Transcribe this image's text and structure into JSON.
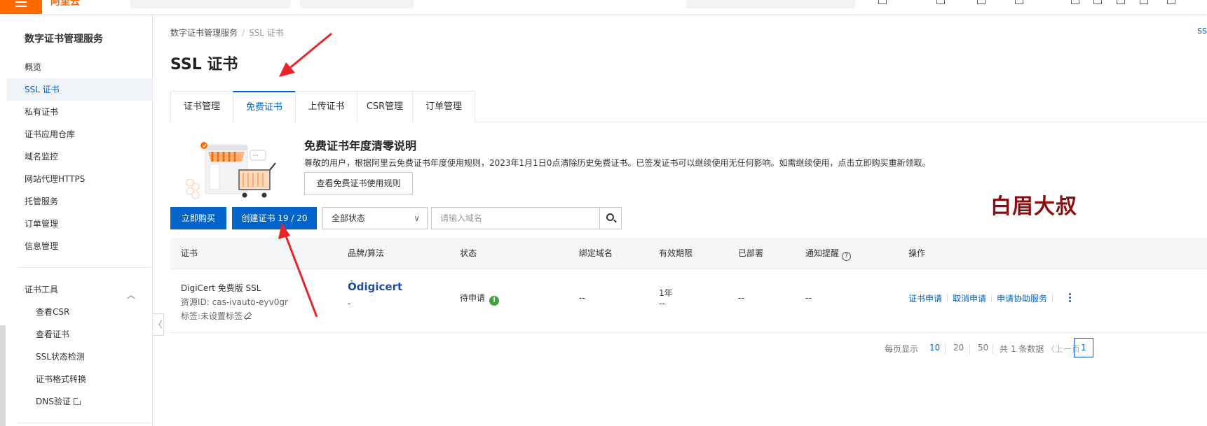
{
  "sidebar": {
    "title": "数字证书管理服务",
    "items": [
      {
        "label": "概览"
      },
      {
        "label": "SSL 证书",
        "active": true
      },
      {
        "label": "私有证书"
      },
      {
        "label": "证书应用仓库"
      },
      {
        "label": "域名监控"
      },
      {
        "label": "网站代理HTTPS"
      },
      {
        "label": "托管服务"
      },
      {
        "label": "订单管理"
      },
      {
        "label": "信息管理"
      }
    ],
    "tools_title": "证书工具",
    "tools": [
      {
        "label": "查看CSR"
      },
      {
        "label": "查看证书"
      },
      {
        "label": "SSL状态检测"
      },
      {
        "label": "证书格式转换"
      },
      {
        "label": "DNS验证"
      }
    ]
  },
  "breadcrumb": {
    "parent": "数字证书管理服务",
    "sep": "/",
    "current": "SSL 证书"
  },
  "top_right_link": "SS",
  "page_title": "SSL 证书",
  "tabs": [
    {
      "label": "证书管理"
    },
    {
      "label": "免费证书",
      "active": true
    },
    {
      "label": "上传证书"
    },
    {
      "label": "CSR管理"
    },
    {
      "label": "订单管理"
    }
  ],
  "banner": {
    "title": "免费证书年度清零说明",
    "text": "尊敬的用户，根据阿里云免费证书年度使用规则，2023年1月1日0点清除历史免费证书。已签发证书可以继续使用无任何影响。如需继续使用，点击立即购买重新领取。",
    "rules_button": "查看免费证书使用规则"
  },
  "toolbar": {
    "buy_label": "立即购买",
    "create_label": "创建证书 19 / 20",
    "status_selected": "全部状态",
    "search_placeholder": "请输入域名"
  },
  "watermark": "白眉大叔",
  "table": {
    "headers": [
      "证书",
      "品牌/算法",
      "状态",
      "绑定域名",
      "有效期限",
      "已部署",
      "通知提醒",
      "操作"
    ],
    "rows": [
      {
        "name": "DigiCert 免费版 SSL",
        "resource_id": "资源ID: cas-ivauto-eyv0gr",
        "tag": "标签:未设置标签",
        "brand": "digicert",
        "algo": "-",
        "status": "待申请",
        "domain": "--",
        "validity": "1年",
        "validity_sub": "--",
        "deployed": "--",
        "notify": "--",
        "ops": [
          "证书申请",
          "取消申请",
          "申请协助服务"
        ]
      }
    ]
  },
  "pagination": {
    "per_page_label": "每页显示",
    "sizes": [
      "10",
      "20",
      "50"
    ],
    "total": "共 1 条数据",
    "prev": "〈上一页",
    "current": "1"
  },
  "colors": {
    "accent": "#0064c8",
    "brand": "#ff6a00",
    "annotation": "#e8232a",
    "watermark": "#8b0d12"
  }
}
